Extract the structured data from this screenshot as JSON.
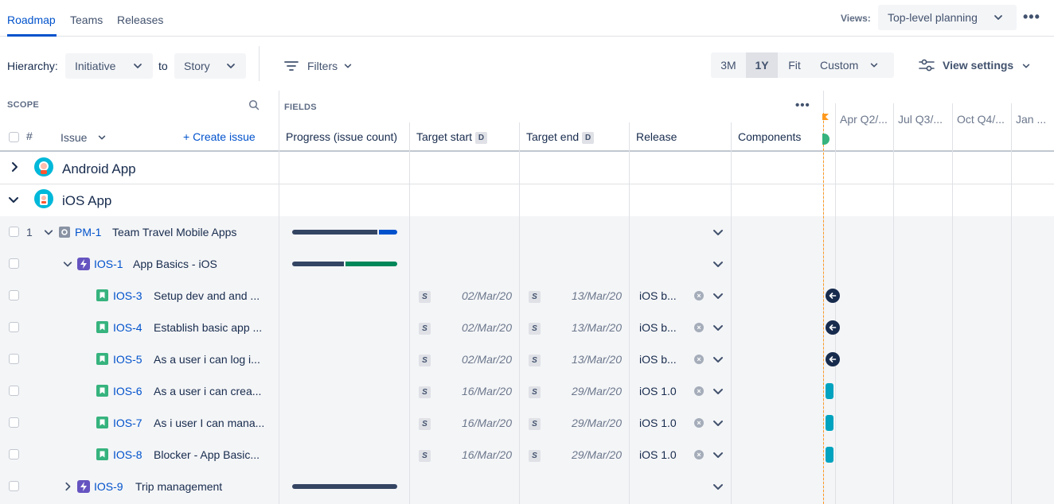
{
  "tabs": [
    {
      "label": "Roadmap",
      "active": true
    },
    {
      "label": "Teams",
      "active": false
    },
    {
      "label": "Releases",
      "active": false
    }
  ],
  "views": {
    "label": "Views:",
    "selected": "Top-level planning"
  },
  "toolbar": {
    "hierarchy_label": "Hierarchy:",
    "hierarchy_from": "Initiative",
    "to_label": "to",
    "hierarchy_to": "Story",
    "filters_label": "Filters",
    "zoom_options": [
      "3M",
      "1Y",
      "Fit",
      "Custom"
    ],
    "zoom_selected": "1Y",
    "view_settings_label": "View settings"
  },
  "scope": {
    "title": "SCOPE",
    "hash_label": "#",
    "issue_label": "Issue",
    "create_issue_label": "+ Create issue"
  },
  "fields": {
    "title": "FIELDS",
    "columns": {
      "progress": "Progress (issue count)",
      "target_start": "Target start",
      "target_end": "Target end",
      "release": "Release",
      "components": "Components"
    },
    "d_badge": "D"
  },
  "timeline": {
    "months": [
      "Apr Q2/...",
      "Jul Q3/...",
      "Oct Q4/...",
      "Jan ..."
    ]
  },
  "groups": [
    {
      "name": "Android App",
      "expanded": false
    },
    {
      "name": "iOS App",
      "expanded": true
    }
  ],
  "rows": [
    {
      "num": "1",
      "key": "PM-1",
      "summary": "Team Travel Mobile Apps",
      "type": "initiative",
      "progress": [
        0.82,
        0.18
      ],
      "colors": [
        "#344563",
        "#0052cc"
      ]
    },
    {
      "num": "",
      "key": "IOS-1",
      "summary": "App Basics - iOS",
      "type": "epic",
      "progress": [
        0.5,
        0.5
      ],
      "colors": [
        "#344563",
        "#00875a"
      ]
    },
    {
      "num": "",
      "key": "IOS-3",
      "summary": "Setup dev and and ...",
      "type": "story",
      "start_badge": "S",
      "start": "02/Mar/20",
      "end_badge": "S",
      "end": "13/Mar/20",
      "release": "iOS b..."
    },
    {
      "num": "",
      "key": "IOS-4",
      "summary": "Establish basic app ...",
      "type": "story",
      "start_badge": "S",
      "start": "02/Mar/20",
      "end_badge": "S",
      "end": "13/Mar/20",
      "release": "iOS b..."
    },
    {
      "num": "",
      "key": "IOS-5",
      "summary": "As a user i can log i...",
      "type": "story",
      "start_badge": "S",
      "start": "02/Mar/20",
      "end_badge": "S",
      "end": "13/Mar/20",
      "release": "iOS b..."
    },
    {
      "num": "",
      "key": "IOS-6",
      "summary": "As a user i can crea...",
      "type": "story",
      "start_badge": "S",
      "start": "16/Mar/20",
      "end_badge": "S",
      "end": "29/Mar/20",
      "release": "iOS 1.0"
    },
    {
      "num": "",
      "key": "IOS-7",
      "summary": "As i user I can mana...",
      "type": "story",
      "start_badge": "S",
      "start": "16/Mar/20",
      "end_badge": "S",
      "end": "29/Mar/20",
      "release": "iOS 1.0"
    },
    {
      "num": "",
      "key": "IOS-8",
      "summary": "Blocker - App Basic...",
      "type": "story",
      "start_badge": "S",
      "start": "16/Mar/20",
      "end_badge": "S",
      "end": "29/Mar/20",
      "release": "iOS 1.0"
    },
    {
      "num": "",
      "key": "IOS-9",
      "summary": "Trip management",
      "type": "epic",
      "progress": [
        1.0
      ],
      "colors": [
        "#344563"
      ]
    }
  ]
}
